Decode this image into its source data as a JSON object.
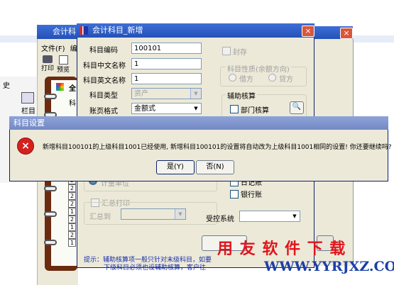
{
  "background_window": {
    "title": "会计科目",
    "menu": [
      "文件(F)",
      "编"
    ],
    "toolbar": {
      "print": "打印",
      "preview": "预览"
    },
    "left_label": "史",
    "left_icon_label": "栏目",
    "book_letter": "全",
    "tree_label": "科",
    "rows": [
      "2",
      "2",
      "2",
      "2",
      "1",
      "2",
      "1",
      "2",
      "1"
    ]
  },
  "dialog": {
    "title": "会计科目_新增",
    "close": "×",
    "fields": {
      "code": {
        "label": "科目编码",
        "value": "100101"
      },
      "cn_name": {
        "label": "科目中文名称",
        "value": "1"
      },
      "en_name": {
        "label": "科目英文名称",
        "value": "1"
      },
      "type": {
        "label": "科目类型",
        "value": "资产"
      },
      "format": {
        "label": "账页格式",
        "value": "金额式"
      }
    },
    "sealed": "封存",
    "nature": {
      "label": "科目性质(余额方向)",
      "debit": "借方",
      "credit": "贷方"
    },
    "aux": {
      "label": "辅助核算",
      "department": "部门核算",
      "journal": "日记账",
      "bank": "银行账"
    },
    "quantity": "计量单位",
    "summary_print": "汇总打印",
    "summary_to": "汇总到",
    "controlled_system": "受控系统",
    "note_line1": "提示：辅助核算项一般只针对末级科目，如要",
    "note_line2": "下级科目必须也设辅助核算，客户往"
  },
  "message_box": {
    "title": "科目设置",
    "message": "新增科目100101的上级科目1001已经使用, 新增科目100101的设置将自动改为上级科目1001相同的设置! 你还要继续吗?",
    "yes": "是(Y)",
    "no": "否(N)"
  },
  "watermark": {
    "text": "用 友 软 件 下 载",
    "url": "WWW.YYRJXZ.COM"
  },
  "colors": {
    "title_bar": "#3d6fd6",
    "watermark_red": "#e0141c",
    "watermark_blue": "#1c3fa8",
    "error_red": "#d62020"
  }
}
